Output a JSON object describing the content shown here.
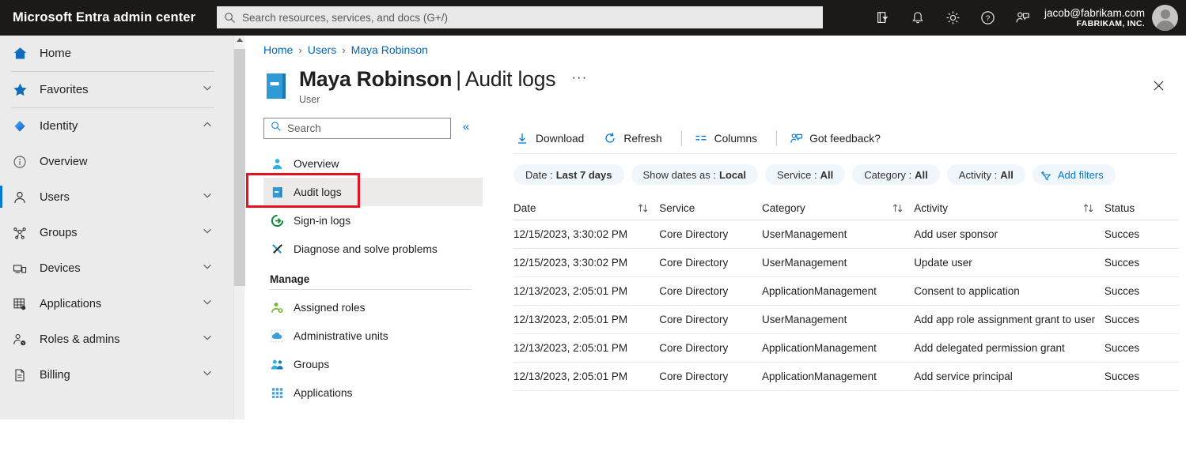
{
  "topbar": {
    "brand": "Microsoft Entra admin center",
    "search_placeholder": "Search resources, services, and docs (G+/)",
    "search_value": "",
    "icons": [
      "directories-filter-icon",
      "notifications-bell-icon",
      "gear-icon",
      "help-question-icon",
      "feedback-person-icon"
    ],
    "account_email": "jacob@fabrikam.com",
    "account_org": "FABRIKAM, INC."
  },
  "sidebar": {
    "items": [
      {
        "label": "Home",
        "icon": "home-icon",
        "chevron": "",
        "active": false
      },
      {
        "label": "Favorites",
        "icon": "star-icon",
        "chevron": "down",
        "active": false
      },
      {
        "label": "Identity",
        "icon": "entra-identity-icon",
        "chevron": "up",
        "active": false
      },
      {
        "label": "Overview",
        "icon": "info-circle-icon",
        "chevron": "",
        "active": false
      },
      {
        "label": "Users",
        "icon": "user-icon",
        "chevron": "down",
        "active": true
      },
      {
        "label": "Groups",
        "icon": "groups-icon",
        "chevron": "down",
        "active": false
      },
      {
        "label": "Devices",
        "icon": "devices-icon",
        "chevron": "down",
        "active": false
      },
      {
        "label": "Applications",
        "icon": "applications-grid-icon",
        "chevron": "down",
        "active": false
      },
      {
        "label": "Roles & admins",
        "icon": "roles-admins-icon",
        "chevron": "down",
        "active": false
      },
      {
        "label": "Billing",
        "icon": "billing-document-icon",
        "chevron": "down",
        "active": false
      }
    ]
  },
  "content": {
    "breadcrumb": [
      "Home",
      "Users",
      "Maya Robinson"
    ],
    "breadcrumb_separator": "›",
    "page_title": "Maya Robinson",
    "page_title_separator": "|",
    "page_title_section": "Audit logs",
    "page_subtitle": "User",
    "ellipsis_label": "···",
    "close_label": "Close"
  },
  "secnav": {
    "search_placeholder": "Search",
    "search_value": "",
    "collapse_label": "«",
    "items": [
      {
        "label": "Overview",
        "icon": "user-overview-icon",
        "selected": false
      },
      {
        "label": "Audit logs",
        "icon": "audit-logs-book-icon",
        "selected": true
      },
      {
        "label": "Sign-in logs",
        "icon": "sign-in-arrow-icon",
        "selected": false
      },
      {
        "label": "Diagnose and solve problems",
        "icon": "wrench-screwdriver-icon",
        "selected": false
      }
    ],
    "group_title": "Manage",
    "manage_items": [
      {
        "label": "Assigned roles",
        "icon": "assigned-roles-icon",
        "selected": false
      },
      {
        "label": "Administrative units",
        "icon": "administrative-units-icon",
        "selected": false
      },
      {
        "label": "Groups",
        "icon": "groups-people-icon",
        "selected": false
      },
      {
        "label": "Applications",
        "icon": "applications-grid-icon",
        "selected": false
      }
    ]
  },
  "toolbar": {
    "buttons": [
      {
        "label": "Download",
        "icon": "download-arrow-icon"
      },
      {
        "label": "Refresh",
        "icon": "refresh-circle-icon"
      },
      {
        "label": "Columns",
        "icon": "columns-lines-icon"
      },
      {
        "label": "Got feedback?",
        "icon": "feedback-person-icon"
      }
    ]
  },
  "filters": {
    "pills": [
      {
        "label": "Date :",
        "value": "Last 7 days"
      },
      {
        "label": "Show dates as :",
        "value": "Local"
      },
      {
        "label": "Service :",
        "value": "All"
      },
      {
        "label": "Category :",
        "value": "All"
      },
      {
        "label": "Activity :",
        "value": "All"
      }
    ],
    "add_filters_label": "Add filters",
    "add_filters_icon": "add-filter-icon"
  },
  "table": {
    "columns": [
      {
        "label": "Date",
        "sortable": true
      },
      {
        "label": "Service",
        "sortable": false
      },
      {
        "label": "Category",
        "sortable": true
      },
      {
        "label": "Activity",
        "sortable": true
      },
      {
        "label": "Status",
        "sortable": false
      }
    ],
    "rows": [
      {
        "date": "12/15/2023, 3:30:02 PM",
        "service": "Core Directory",
        "category": "UserManagement",
        "activity": "Add user sponsor",
        "status": "Succes"
      },
      {
        "date": "12/15/2023, 3:30:02 PM",
        "service": "Core Directory",
        "category": "UserManagement",
        "activity": "Update user",
        "status": "Succes"
      },
      {
        "date": "12/13/2023, 2:05:01 PM",
        "service": "Core Directory",
        "category": "ApplicationManagement",
        "activity": "Consent to application",
        "status": "Succes"
      },
      {
        "date": "12/13/2023, 2:05:01 PM",
        "service": "Core Directory",
        "category": "UserManagement",
        "activity": "Add app role assignment grant to user",
        "status": "Succes"
      },
      {
        "date": "12/13/2023, 2:05:01 PM",
        "service": "Core Directory",
        "category": "ApplicationManagement",
        "activity": "Add delegated permission grant",
        "status": "Succes"
      },
      {
        "date": "12/13/2023, 2:05:01 PM",
        "service": "Core Directory",
        "category": "ApplicationManagement",
        "activity": "Add service principal",
        "status": "Succes"
      }
    ]
  },
  "colors": {
    "topbar_bg": "#1b1a19",
    "sidebar_bg": "#ebebeb",
    "accent_blue": "#0078d4",
    "link_blue": "#0067b8",
    "pill_bg": "#eff6fc",
    "highlight_red": "#e81123",
    "selected_row_bg": "#edebe9"
  }
}
